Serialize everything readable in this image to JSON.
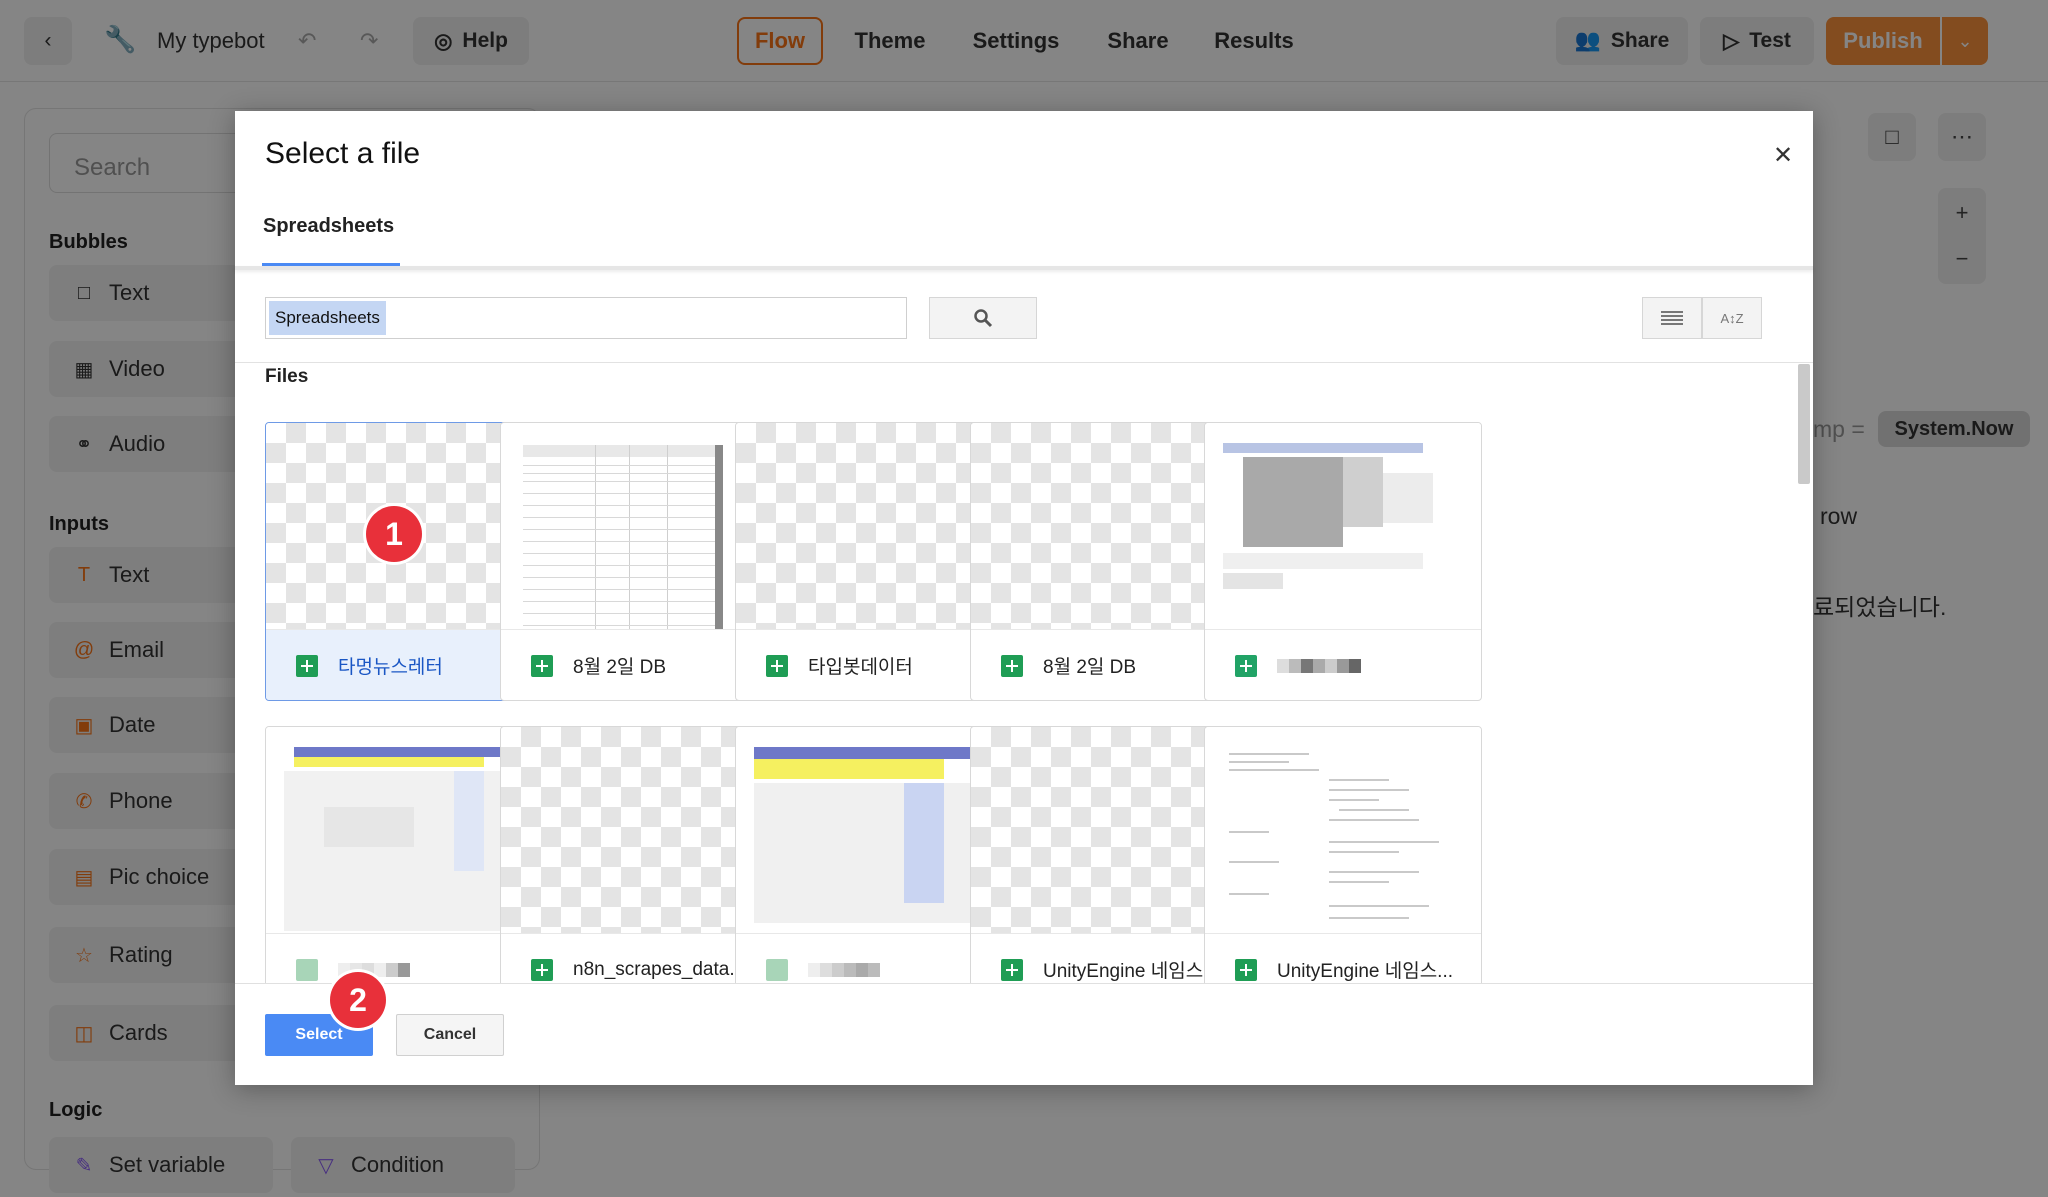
{
  "topbar": {
    "back_icon": "chevron-left-icon",
    "project_icon": "wrench-icon",
    "project_name": "My typebot",
    "help_label": "Help",
    "nav_tabs": [
      {
        "label": "Flow",
        "active": true
      },
      {
        "label": "Theme"
      },
      {
        "label": "Settings"
      },
      {
        "label": "Share"
      },
      {
        "label": "Results"
      }
    ],
    "share_label": "Share",
    "test_label": "Test",
    "publish_label": "Publish"
  },
  "sidebar": {
    "search_placeholder": "Search",
    "bubbles_heading": "Bubbles",
    "bubbles": [
      {
        "label": "Text",
        "icon": "chat-bubble-icon"
      },
      {
        "label": "Video",
        "icon": "film-icon"
      },
      {
        "label": "Audio",
        "icon": "headphones-icon"
      }
    ],
    "inputs_heading": "Inputs",
    "inputs": [
      {
        "label": "Text",
        "icon": "text-t-icon"
      },
      {
        "label": "Email",
        "icon": "at-sign-icon"
      },
      {
        "label": "Date",
        "icon": "calendar-icon"
      },
      {
        "label": "Phone",
        "icon": "phone-icon"
      },
      {
        "label": "Pic choice",
        "icon": "image-icon"
      },
      {
        "label": "Rating",
        "icon": "star-icon"
      },
      {
        "label": "Cards",
        "icon": "cards-icon"
      }
    ],
    "logic_heading": "Logic",
    "logic": [
      {
        "label": "Set variable",
        "icon": "pen-icon"
      },
      {
        "label": "Condition",
        "icon": "filter-icon"
      }
    ]
  },
  "canvas": {
    "timestamp_fragment": "mp =",
    "system_now": "System.Now",
    "row_fragment": "row",
    "korean_fragment": "료되었습니다."
  },
  "modal": {
    "title": "Select a file",
    "tab_label": "Spreadsheets",
    "search_value": "Spreadsheets",
    "files_label": "Files",
    "files": [
      {
        "name": "타멍뉴스레터",
        "selected": true
      },
      {
        "name": "8월 2일 DB"
      },
      {
        "name": "타입봇데이터"
      },
      {
        "name": "8월 2일 DB"
      },
      {
        "name": ""
      },
      {
        "name": ""
      },
      {
        "name": "n8n_scrapes_data..."
      },
      {
        "name": ""
      },
      {
        "name": "UnityEngine 네임스..."
      },
      {
        "name": "UnityEngine 네임스..."
      }
    ],
    "select_label": "Select",
    "cancel_label": "Cancel"
  },
  "annotations": {
    "step1": "1",
    "step2": "2"
  },
  "colors": {
    "accent_orange": "#f97316",
    "publish_orange": "#fb923c",
    "google_blue": "#4a8af4",
    "sheets_green": "#1f9d55",
    "badge_red": "#e8303a"
  }
}
